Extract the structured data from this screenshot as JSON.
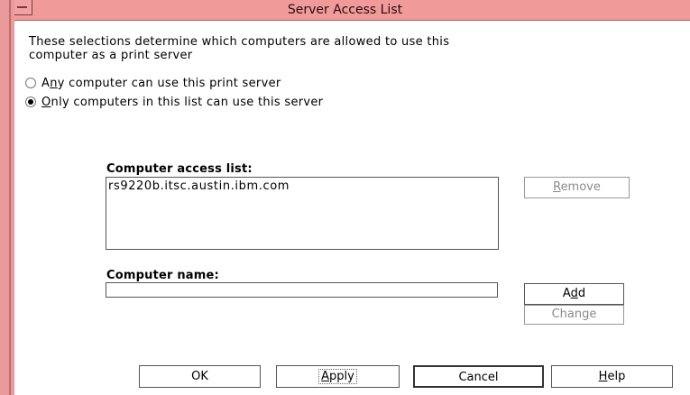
{
  "window": {
    "title": "Server Access List"
  },
  "description": {
    "line1": "These selections determine which computers are allowed to use this",
    "line2": "computer as a print server"
  },
  "radios": [
    {
      "pre": "A",
      "mnemonic": "n",
      "post": "y computer can use this print server",
      "checked": false
    },
    {
      "pre": "",
      "mnemonic": "O",
      "post": "nly computers in this list can use this server",
      "checked": true
    }
  ],
  "access_list": {
    "label": "Computer access list:",
    "items": [
      "rs9220b.itsc.austin.ibm.com"
    ]
  },
  "computer_name": {
    "label": "Computer name:",
    "value": ""
  },
  "buttons": {
    "remove": {
      "mnemonic": "R",
      "rest": "emove"
    },
    "add": {
      "pre": "A",
      "mnemonic": "d",
      "post": "d"
    },
    "change": {
      "pre": "Chan",
      "mnemonic": "g",
      "post": "e"
    },
    "ok": "OK",
    "apply": {
      "mnemonic": "A",
      "rest": "pply"
    },
    "cancel": "Cancel",
    "help": {
      "mnemonic": "H",
      "rest": "elp"
    }
  },
  "colors": {
    "titlebar": "#f09a9a",
    "frame": "#ea9a9a"
  }
}
